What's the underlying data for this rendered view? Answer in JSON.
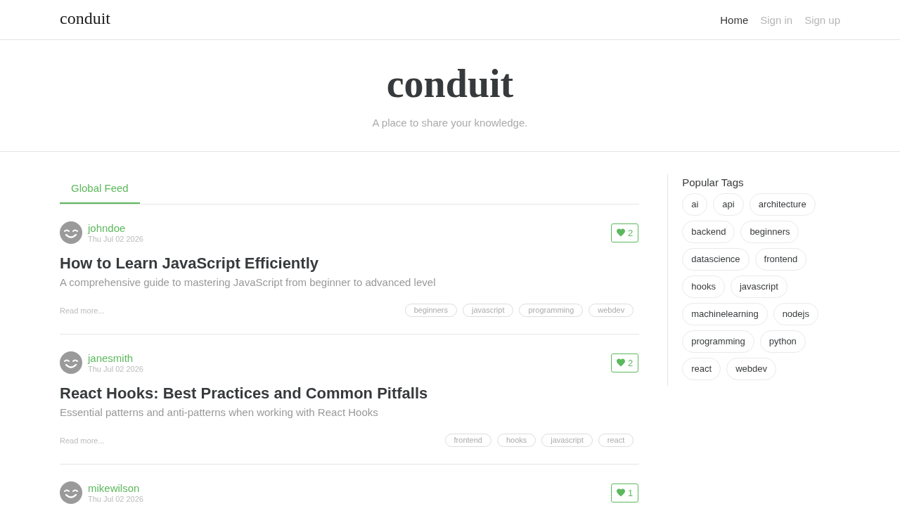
{
  "navbar": {
    "brand": "conduit",
    "links": [
      {
        "label": "Home",
        "selected": true
      },
      {
        "label": "Sign in",
        "selected": false
      },
      {
        "label": "Sign up",
        "selected": false
      }
    ]
  },
  "banner": {
    "title": "conduit",
    "subtitle": "A place to share your knowledge."
  },
  "feed_tabs": [
    {
      "label": "Global Feed",
      "selected": true
    }
  ],
  "articles": [
    {
      "author": "johndoe",
      "date": "Thu Jul 02 2026",
      "likes": "2",
      "title": "How to Learn JavaScript Efficiently",
      "description": "A comprehensive guide to mastering JavaScript from beginner to advanced level",
      "read_more": "Read more...",
      "tags": [
        "beginners",
        "javascript",
        "programming",
        "webdev"
      ]
    },
    {
      "author": "janesmith",
      "date": "Thu Jul 02 2026",
      "likes": "2",
      "title": "React Hooks: Best Practices and Common Pitfalls",
      "description": "Essential patterns and anti-patterns when working with React Hooks",
      "read_more": "Read more...",
      "tags": [
        "frontend",
        "hooks",
        "javascript",
        "react"
      ]
    },
    {
      "author": "mikewilson",
      "date": "Thu Jul 02 2026",
      "likes": "1"
    }
  ],
  "sidebar": {
    "title": "Popular Tags",
    "tags": [
      "ai",
      "api",
      "architecture",
      "backend",
      "beginners",
      "datascience",
      "frontend",
      "hooks",
      "javascript",
      "machinelearning",
      "nodejs",
      "programming",
      "python",
      "react",
      "webdev"
    ]
  }
}
